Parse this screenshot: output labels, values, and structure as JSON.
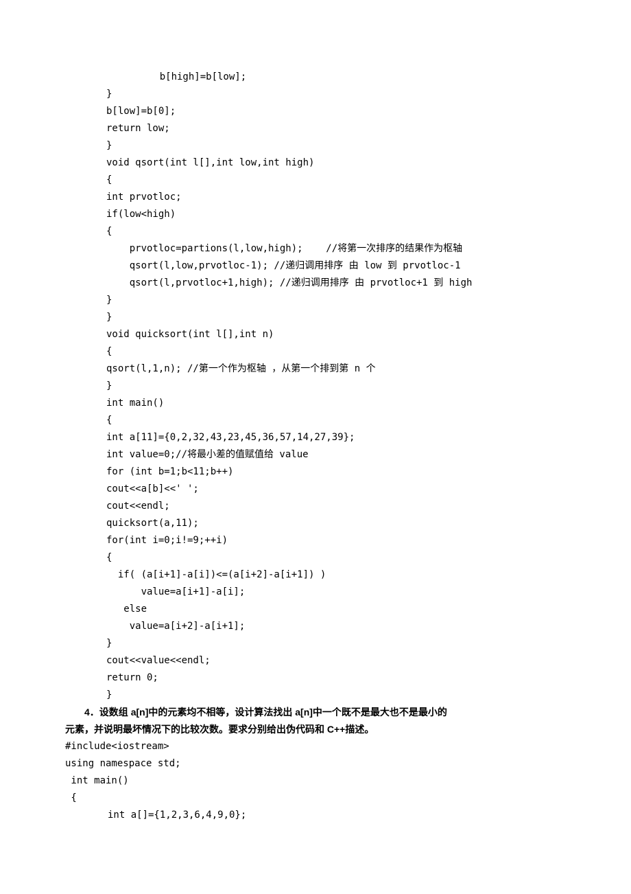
{
  "code1": {
    "l01": "    b[high]=b[low];",
    "l02": "}",
    "l03": "b[low]=b[0];",
    "l04": "return low;",
    "l05": "}",
    "l06": "void qsort(int l[],int low,int high)",
    "l07": "{",
    "l08": "int prvotloc;",
    "l09": "if(low<high)",
    "l10": "{",
    "l11": "    prvotloc=partions(l,low,high);    //将第一次排序的结果作为枢轴",
    "l12": "    qsort(l,low,prvotloc-1); //递归调用排序 由 low 到 prvotloc-1",
    "l13": "    qsort(l,prvotloc+1,high); //递归调用排序 由 prvotloc+1 到 high",
    "l14": "}",
    "l15": "}",
    "l16": "void quicksort(int l[],int n)",
    "l17": "{",
    "l18": "qsort(l,1,n); //第一个作为枢轴 ，从第一个排到第 n 个",
    "l19": "}",
    "l20": "int main()",
    "l21": "{",
    "l22": "int a[11]={0,2,32,43,23,45,36,57,14,27,39};",
    "l23": "int value=0;//将最小差的值赋值给 value",
    "l24": "for (int b=1;b<11;b++)",
    "l25": "cout<<a[b]<<' ';",
    "l26": "cout<<endl;",
    "l27": "quicksort(a,11);",
    "l28": "for(int i=0;i!=9;++i)",
    "l29": "{",
    "l30": "  if( (a[i+1]-a[i])<=(a[i+2]-a[i+1]) )",
    "l31": "      value=a[i+1]-a[i];",
    "l32": "   else",
    "l33": "    value=a[i+2]-a[i+1];",
    "l34": "}",
    "l35": "cout<<value<<endl;",
    "l36": "return 0;",
    "l37": "}"
  },
  "heading": {
    "number": "4．",
    "text1": "设数组 ",
    "bold1": "a[n]",
    "text2": "中的元素均不相等，设计算法找出 ",
    "bold2": "a[n]",
    "text3": "中一个既不是最大也不是最小的",
    "cont": "元素，并说明最坏情况下的比较次数。要求分别给出伪代码和 C++描述。"
  },
  "code2": {
    "l01": "#include<iostream>",
    "l02": "using namespace std;",
    "l03": " int main()",
    "l04": " {",
    "l05": "int a[]={1,2,3,6,4,9,0};"
  }
}
